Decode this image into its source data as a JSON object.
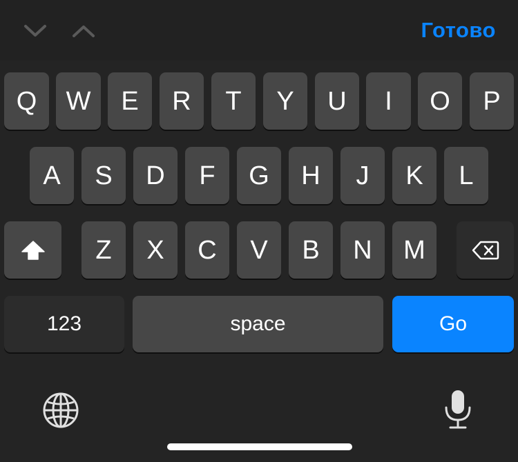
{
  "toolbar": {
    "prev_icon": "chevron-down-icon",
    "next_icon": "chevron-up-icon",
    "done_label": "Готово",
    "done_color": "#0a84ff"
  },
  "keyboard": {
    "row1": [
      "Q",
      "W",
      "E",
      "R",
      "T",
      "Y",
      "U",
      "I",
      "O",
      "P"
    ],
    "row2": [
      "A",
      "S",
      "D",
      "F",
      "G",
      "H",
      "J",
      "K",
      "L"
    ],
    "row3": [
      "Z",
      "X",
      "C",
      "V",
      "B",
      "N",
      "M"
    ],
    "shift_icon": "shift-icon",
    "delete_icon": "backspace-icon",
    "numbers_label": "123",
    "space_label": "space",
    "go_label": "Go",
    "globe_icon": "globe-icon",
    "mic_icon": "microphone-icon",
    "accent_color": "#0a84ff"
  }
}
